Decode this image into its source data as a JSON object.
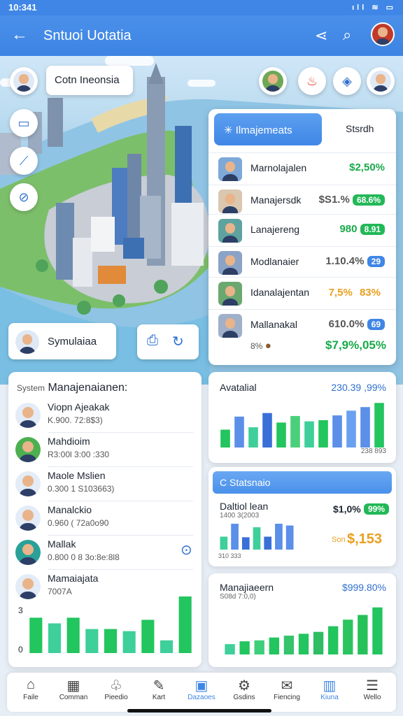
{
  "status": {
    "time": "10:341",
    "icons": "ıll ≋ ▭"
  },
  "appbar": {
    "title": "Sntuoi Uotatia",
    "back_icon": "back-arrow-icon",
    "share_icon": "share-icon",
    "search_icon": "search-icon"
  },
  "map": {
    "location_label": "Cotn Ineonsia",
    "sim_label": "Symulaiaa",
    "top_icons": [
      "character-icon",
      "fire-icon",
      "tag-icon",
      "user-icon"
    ]
  },
  "panel": {
    "tab_active": "Ilmajemeats",
    "tab_other": "Stsrdh",
    "rows": [
      {
        "name": "Marnolajalen",
        "value": "$2,50%",
        "badge": "",
        "value_color": "#18a94a",
        "badge_color": ""
      },
      {
        "name": "Manajersdk",
        "value": "$S1.%",
        "badge": "68.6%",
        "value_color": "#555555",
        "badge_color": "#22b857"
      },
      {
        "name": "Lanajereng",
        "value": "980",
        "badge": "8.91",
        "value_color": "#18a94a",
        "badge_color": "#22b857"
      },
      {
        "name": "Modlanaier",
        "value": "1.10.4%",
        "badge": "29",
        "value_color": "#555555",
        "badge_color": "#3f86e6"
      },
      {
        "name": "Idanalajentan",
        "value": "7,5%",
        "badge": "83%",
        "value_color": "#e8a020",
        "badge_color": ""
      },
      {
        "name": "Mallanakal",
        "value": "610.0%",
        "badge": "69",
        "value_color": "#555555",
        "badge_color": "#3f86e6"
      }
    ],
    "footer_icon": "coin-bag-icon",
    "footer_value": "$7,9%,05%",
    "footer_small": "8%"
  },
  "left_card": {
    "title_small": "System",
    "title": "Manajenaianen:",
    "items": [
      {
        "name": "Viopn Ajeakak",
        "sub": "K.900. 72:8$3)"
      },
      {
        "name": "Mahdioim",
        "sub": "R3:00l 3:00 :330"
      },
      {
        "name": "Maole Mslien",
        "sub": "0.300 1 S103663)"
      },
      {
        "name": "Manalckio",
        "sub": "0.960 ( 72a0o90"
      },
      {
        "name": "Mallak",
        "sub": "0.800 0 8 3o:8e:8l8"
      },
      {
        "name": "Mamaiajata",
        "sub": "7007A"
      }
    ],
    "chart_ylabels": [
      "3",
      "0"
    ]
  },
  "right_cards": [
    {
      "title": "Avatalial",
      "value": "230.39 ,99%",
      "foot": "238 893"
    },
    {
      "header": "C Statsnaio",
      "title": "Daltiol lean",
      "sub": "1400 3(2003",
      "value": "$1,0%",
      "badge": "99%",
      "foot_small": "Son",
      "foot_value": "$,153",
      "axis": "310   333"
    },
    {
      "title": "Manajiaeern",
      "value": "$999.80%",
      "sub": "S08d 7:0,0)"
    }
  ],
  "chart_data": [
    {
      "type": "bar",
      "values": [
        5,
        4.2,
        5,
        3.4,
        3.4,
        3.1,
        4.7,
        1.8,
        8
      ]
    },
    {
      "type": "bar",
      "values": [
        3,
        5.2,
        3.4,
        5.8,
        4.2,
        5.3,
        4.4,
        4.6,
        5.4,
        6.2,
        6.8,
        7.5
      ]
    },
    {
      "type": "bar",
      "values": [
        2.2,
        4.4,
        2.1,
        3.8,
        2.2,
        4.4,
        4.1
      ]
    },
    {
      "type": "bar",
      "values": [
        1.1,
        1.4,
        1.5,
        1.8,
        2.0,
        2.2,
        2.4,
        3.0,
        3.7,
        4.2,
        5.0
      ]
    }
  ],
  "colors": {
    "accent": "#3f86e6",
    "green": "#22c55e",
    "teal": "#3ecf9a",
    "blue": "#5b8fe8",
    "orange": "#e8a020"
  },
  "nav": [
    {
      "icon": "home-icon",
      "label": "Faile"
    },
    {
      "icon": "calculator-icon",
      "label": "Comman"
    },
    {
      "icon": "leaf-icon",
      "label": "Pieedio"
    },
    {
      "icon": "tool-icon",
      "label": "Kart"
    },
    {
      "icon": "briefcase-icon",
      "label": "Dazaoes"
    },
    {
      "icon": "gear-icon",
      "label": "Gsdins"
    },
    {
      "icon": "mail-icon",
      "label": "Fiencing"
    },
    {
      "icon": "chart-icon",
      "label": "Kiuna"
    },
    {
      "icon": "menu-icon",
      "label": "Wello"
    }
  ]
}
